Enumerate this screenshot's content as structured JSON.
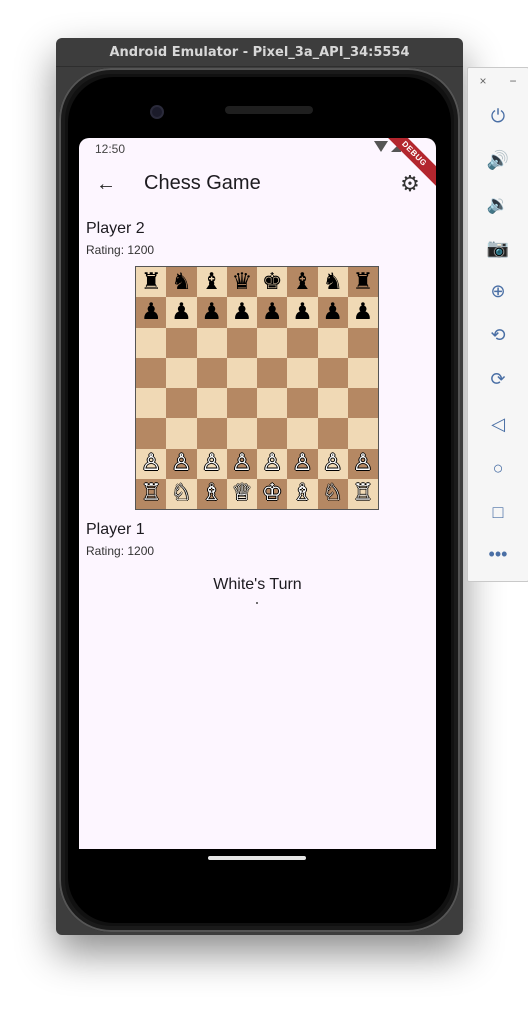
{
  "emulator": {
    "title": "Android Emulator - Pixel_3a_API_34:5554",
    "panel": {
      "close_label": "×",
      "minimize_label": "−",
      "buttons": [
        {
          "name": "power-icon",
          "glyph": "⏻"
        },
        {
          "name": "volume-up-icon",
          "glyph": "🔊"
        },
        {
          "name": "volume-down-icon",
          "glyph": "🔉"
        },
        {
          "name": "camera-icon",
          "glyph": "📷"
        },
        {
          "name": "zoom-icon",
          "glyph": "⊕"
        },
        {
          "name": "rotate-left-icon",
          "glyph": "⟲"
        },
        {
          "name": "rotate-right-icon",
          "glyph": "⟳"
        },
        {
          "name": "back-nav-icon",
          "glyph": "◁"
        },
        {
          "name": "home-nav-icon",
          "glyph": "○"
        },
        {
          "name": "overview-nav-icon",
          "glyph": "□"
        },
        {
          "name": "more-icon",
          "glyph": "•••"
        }
      ]
    }
  },
  "status_bar": {
    "time": "12:50",
    "debug_banner": "DEBUG"
  },
  "app_bar": {
    "back_icon": "←",
    "title": "Chess Game",
    "settings_icon": "⚙"
  },
  "player_top": {
    "name": "Player 2",
    "rating": "Rating: 1200"
  },
  "player_bottom": {
    "name": "Player 1",
    "rating": "Rating: 1200"
  },
  "board": {
    "rows": [
      [
        "♜",
        "♞",
        "♝",
        "♛",
        "♚",
        "♝",
        "♞",
        "♜"
      ],
      [
        "♟",
        "♟",
        "♟",
        "♟",
        "♟",
        "♟",
        "♟",
        "♟"
      ],
      [
        "",
        "",
        "",
        "",
        "",
        "",
        "",
        ""
      ],
      [
        "",
        "",
        "",
        "",
        "",
        "",
        "",
        ""
      ],
      [
        "",
        "",
        "",
        "",
        "",
        "",
        "",
        ""
      ],
      [
        "",
        "",
        "",
        "",
        "",
        "",
        "",
        ""
      ],
      [
        "♙",
        "♙",
        "♙",
        "♙",
        "♙",
        "♙",
        "♙",
        "♙"
      ],
      [
        "♖",
        "♘",
        "♗",
        "♕",
        "♔",
        "♗",
        "♘",
        "♖"
      ]
    ],
    "light_color": "#f0d9b5",
    "dark_color": "#b58863"
  },
  "turn_label": "White's Turn",
  "colors": {
    "screen_bg": "#fdf6ff",
    "debug_ribbon": "#b3262e"
  }
}
